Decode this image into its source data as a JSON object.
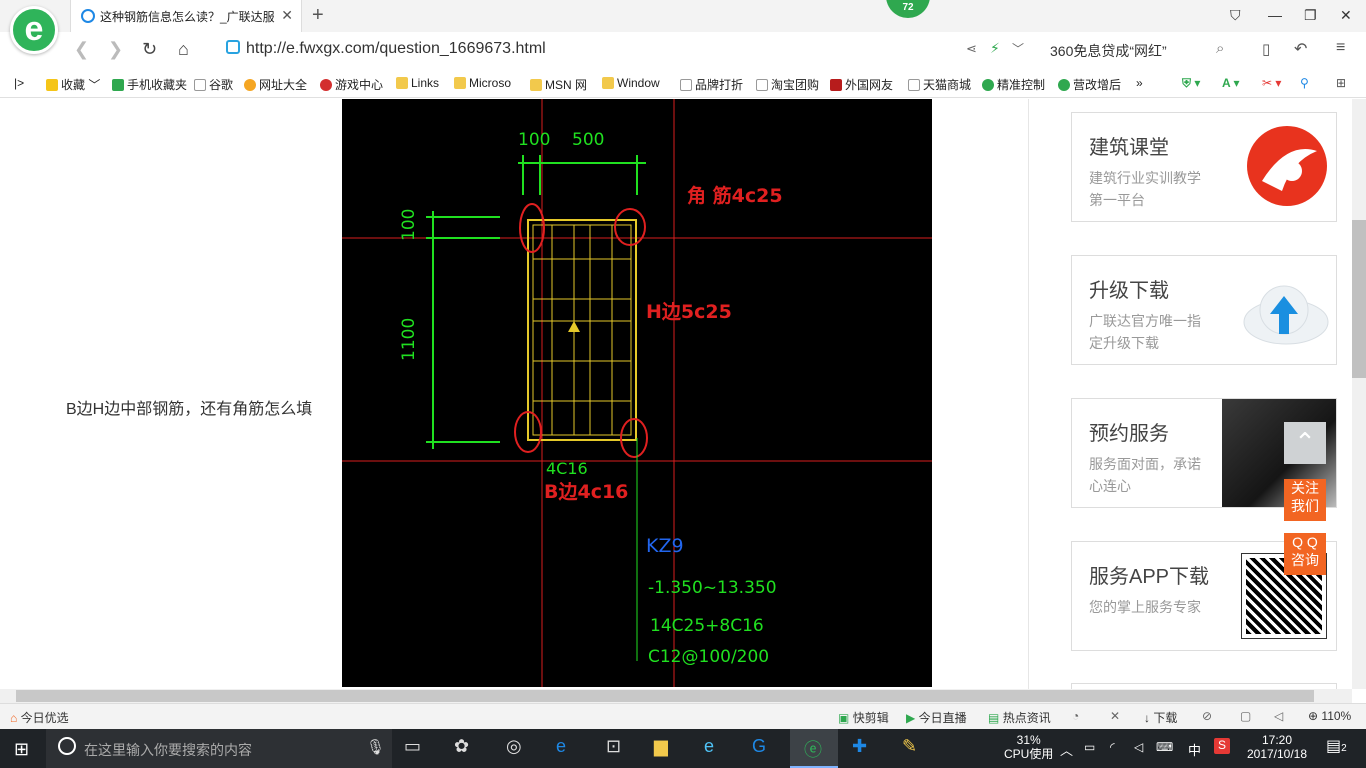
{
  "browser": {
    "tab_title": "这种钢筋信息怎么读？_广联达服",
    "notification_count": "72",
    "url": "http://e.fwxgx.com/question_1669673.html",
    "search_text": "360免息贷成“网红”"
  },
  "bookmarks": [
    "收藏",
    "手机收藏夹",
    "谷歌",
    "网址大全",
    "游戏中心",
    "Links",
    "Microso",
    "MSN 网",
    "Window",
    "品牌打折",
    "淘宝团购",
    "外国网友",
    "天猫商城",
    "精准控制",
    "营改增后"
  ],
  "page": {
    "question_text": "B边H边中部钢筋，还有角筋怎么填",
    "drawing": {
      "dim_top_1": "100",
      "dim_top_2": "500",
      "dim_left_1": "100",
      "dim_left_2": "1100",
      "annot_corner": "角 筋4c25",
      "annot_h": "H边5c25",
      "annot_b_green": "4C16",
      "annot_b_red": "B边4c16",
      "column_id": "KZ9",
      "elevation": "-1.350~13.350",
      "rebar": "14C25+8C16",
      "stirrup": "C12@100/200"
    }
  },
  "sidebar": {
    "cards": [
      {
        "title": "建筑课堂",
        "desc": "建筑行业实训教学第一平台"
      },
      {
        "title": "升级下载",
        "desc": "广联达官方唯一指定升级下载"
      },
      {
        "title": "预约服务",
        "desc": "服务面对面，承诺心连心"
      },
      {
        "title": "服务APP下载",
        "desc": "您的掌上服务专家"
      }
    ],
    "follow_label": "关注我们",
    "qq_label": "Q Q 咨询"
  },
  "statusbar": {
    "left": "今日优选",
    "items": [
      "快剪辑",
      "今日直播",
      "热点资讯",
      "下载"
    ],
    "zoom": "110%"
  },
  "taskbar": {
    "search_placeholder": "在这里输入你要搜索的内容",
    "cpu_percent": "31%",
    "cpu_label": "CPU使用",
    "ime": "中",
    "time": "17:20",
    "date": "2017/10/18",
    "notifications": "2"
  }
}
